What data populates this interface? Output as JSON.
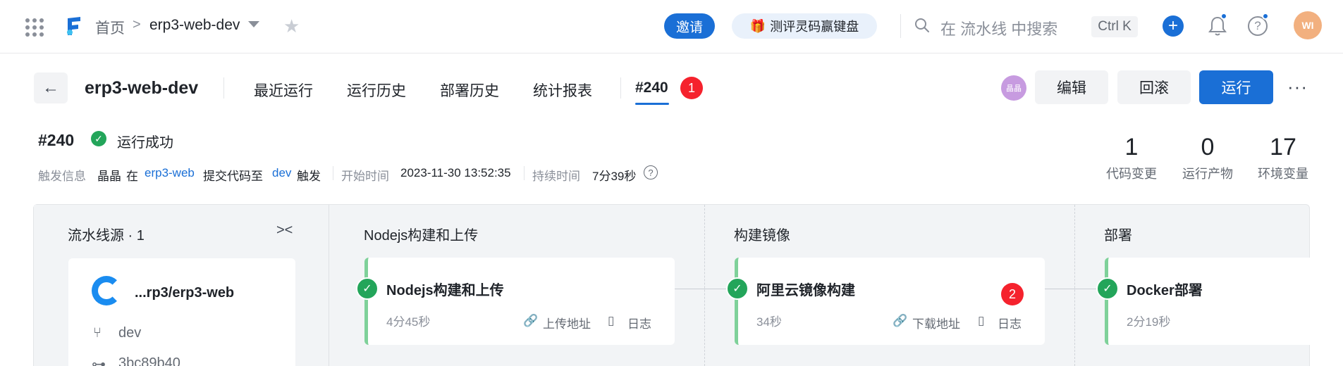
{
  "topbar": {
    "breadcrumb_home": "首页",
    "breadcrumb_sep": ">",
    "project": "erp3-web-dev",
    "invite_label": "邀请",
    "promo_label": "测评灵码赢键盘",
    "search_placeholder": "在 流水线 中搜索",
    "shortcut": "Ctrl K",
    "avatar_text": "WI",
    "accent": "#1a6fd6"
  },
  "header": {
    "title": "erp3-web-dev",
    "tabs": [
      "最近运行",
      "运行历史",
      "部署历史",
      "统计报表",
      "#240"
    ],
    "tab_badge": "1",
    "member_avatar": "晶晶",
    "edit_label": "编辑",
    "rollback_label": "回滚",
    "run_label": "运行",
    "more_label": "···"
  },
  "run": {
    "number": "#240",
    "status": "运行成功",
    "trigger_label": "触发信息",
    "user": "晶晶",
    "in_word": "在",
    "repo": "erp3-web",
    "commit_to": "提交代码至",
    "branch": "dev",
    "triggered": "触发",
    "start_label": "开始时间",
    "start_time": "2023-11-30 13:52:35",
    "duration_label": "持续时间",
    "duration": "7分39秒",
    "stats": [
      {
        "value": "1",
        "label": "代码变更"
      },
      {
        "value": "0",
        "label": "运行产物"
      },
      {
        "value": "17",
        "label": "环境变量"
      }
    ]
  },
  "pipeline": {
    "source": {
      "title": "流水线源 · 1",
      "repo_name": "...rp3/erp3-web",
      "branch": "dev",
      "commit": "3bc89b40"
    },
    "stages": [
      {
        "title": "Nodejs构建和上传",
        "job": "Nodejs构建和上传",
        "time": "4分45秒",
        "link": "上传地址",
        "log": "日志"
      },
      {
        "title": "构建镜像",
        "job": "阿里云镜像构建",
        "time": "34秒",
        "link": "下载地址",
        "log": "日志",
        "badge": "2"
      },
      {
        "title": "部署",
        "job": "Docker部署",
        "time": "2分19秒"
      }
    ]
  }
}
